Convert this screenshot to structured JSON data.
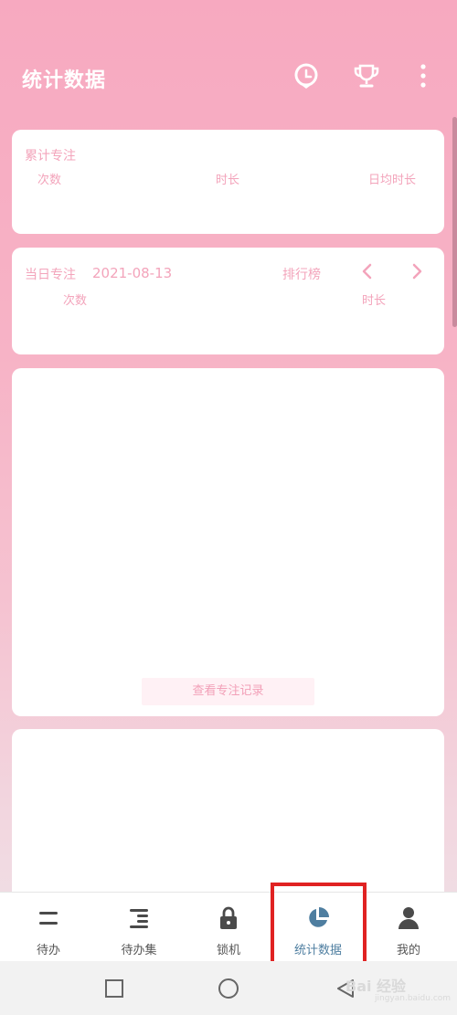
{
  "appbar": {
    "title": "统计数据",
    "icons": [
      "alarm-clock-icon",
      "trophy-icon",
      "more-vertical-icon"
    ]
  },
  "cumulative": {
    "title": "累计专注",
    "labels": {
      "count": "次数",
      "duration": "时长",
      "daily_avg": "日均时长"
    }
  },
  "daily": {
    "title": "当日专注",
    "date": "2021-08-13",
    "ranking": "排行榜",
    "labels": {
      "count": "次数",
      "duration": "时长"
    }
  },
  "records_button": "查看专注记录",
  "bottom_nav": [
    {
      "label": "待办",
      "icon": "todo-icon"
    },
    {
      "label": "待办集",
      "icon": "todo-set-icon"
    },
    {
      "label": "锁机",
      "icon": "lock-icon"
    },
    {
      "label": "统计数据",
      "icon": "pie-chart-icon",
      "active": true
    },
    {
      "label": "我的",
      "icon": "person-icon"
    }
  ],
  "watermark": {
    "text": "Bai 经验",
    "sub": "jingyan.baidu.com"
  },
  "colors": {
    "accent": "#4e7ea0",
    "pink": "#f7a9c0",
    "label_pink": "#f3a4bb",
    "highlight": "#e02222"
  }
}
